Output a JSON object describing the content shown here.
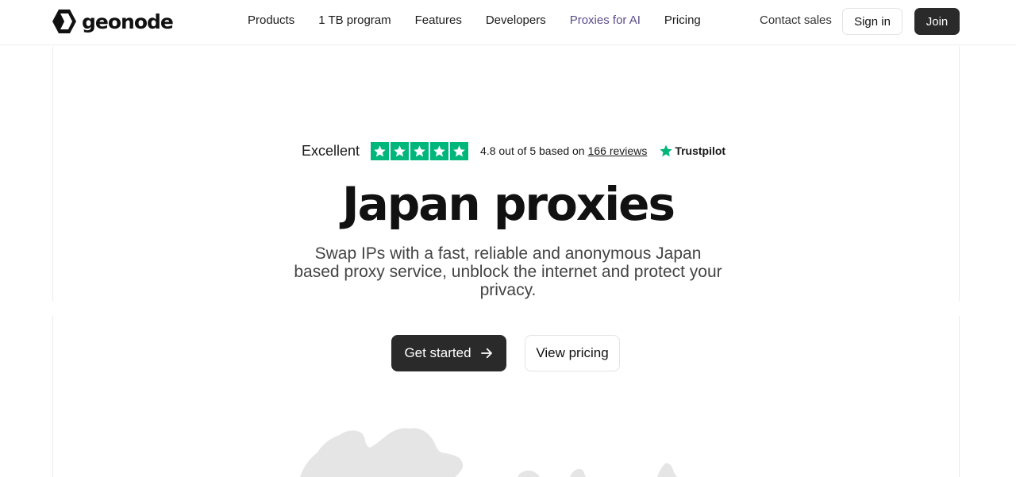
{
  "brand": {
    "name": "geonode"
  },
  "nav": {
    "links": [
      "Products",
      "1 TB program",
      "Features",
      "Developers",
      "Proxies for AI",
      "Pricing"
    ],
    "contact": "Contact sales",
    "signin": "Sign in",
    "join": "Join"
  },
  "trustpilot": {
    "label": "Excellent",
    "stars": 5,
    "rating_text": "4.8 out of 5 based on",
    "reviews_text": "166 reviews",
    "brand": "Trustpilot",
    "star_color": "#00b67a"
  },
  "hero": {
    "title": "Japan proxies",
    "subtitle": "Swap IPs with a fast, reliable and anonymous Japan based proxy service, unblock the internet and protect your privacy."
  },
  "cta": {
    "primary": "Get started",
    "secondary": "View pricing"
  },
  "colors": {
    "accent": "#5b4c8a",
    "dark_button": "#2a2a2a",
    "trustpilot_green": "#00b67a",
    "map_gray": "#e5e5e5"
  }
}
